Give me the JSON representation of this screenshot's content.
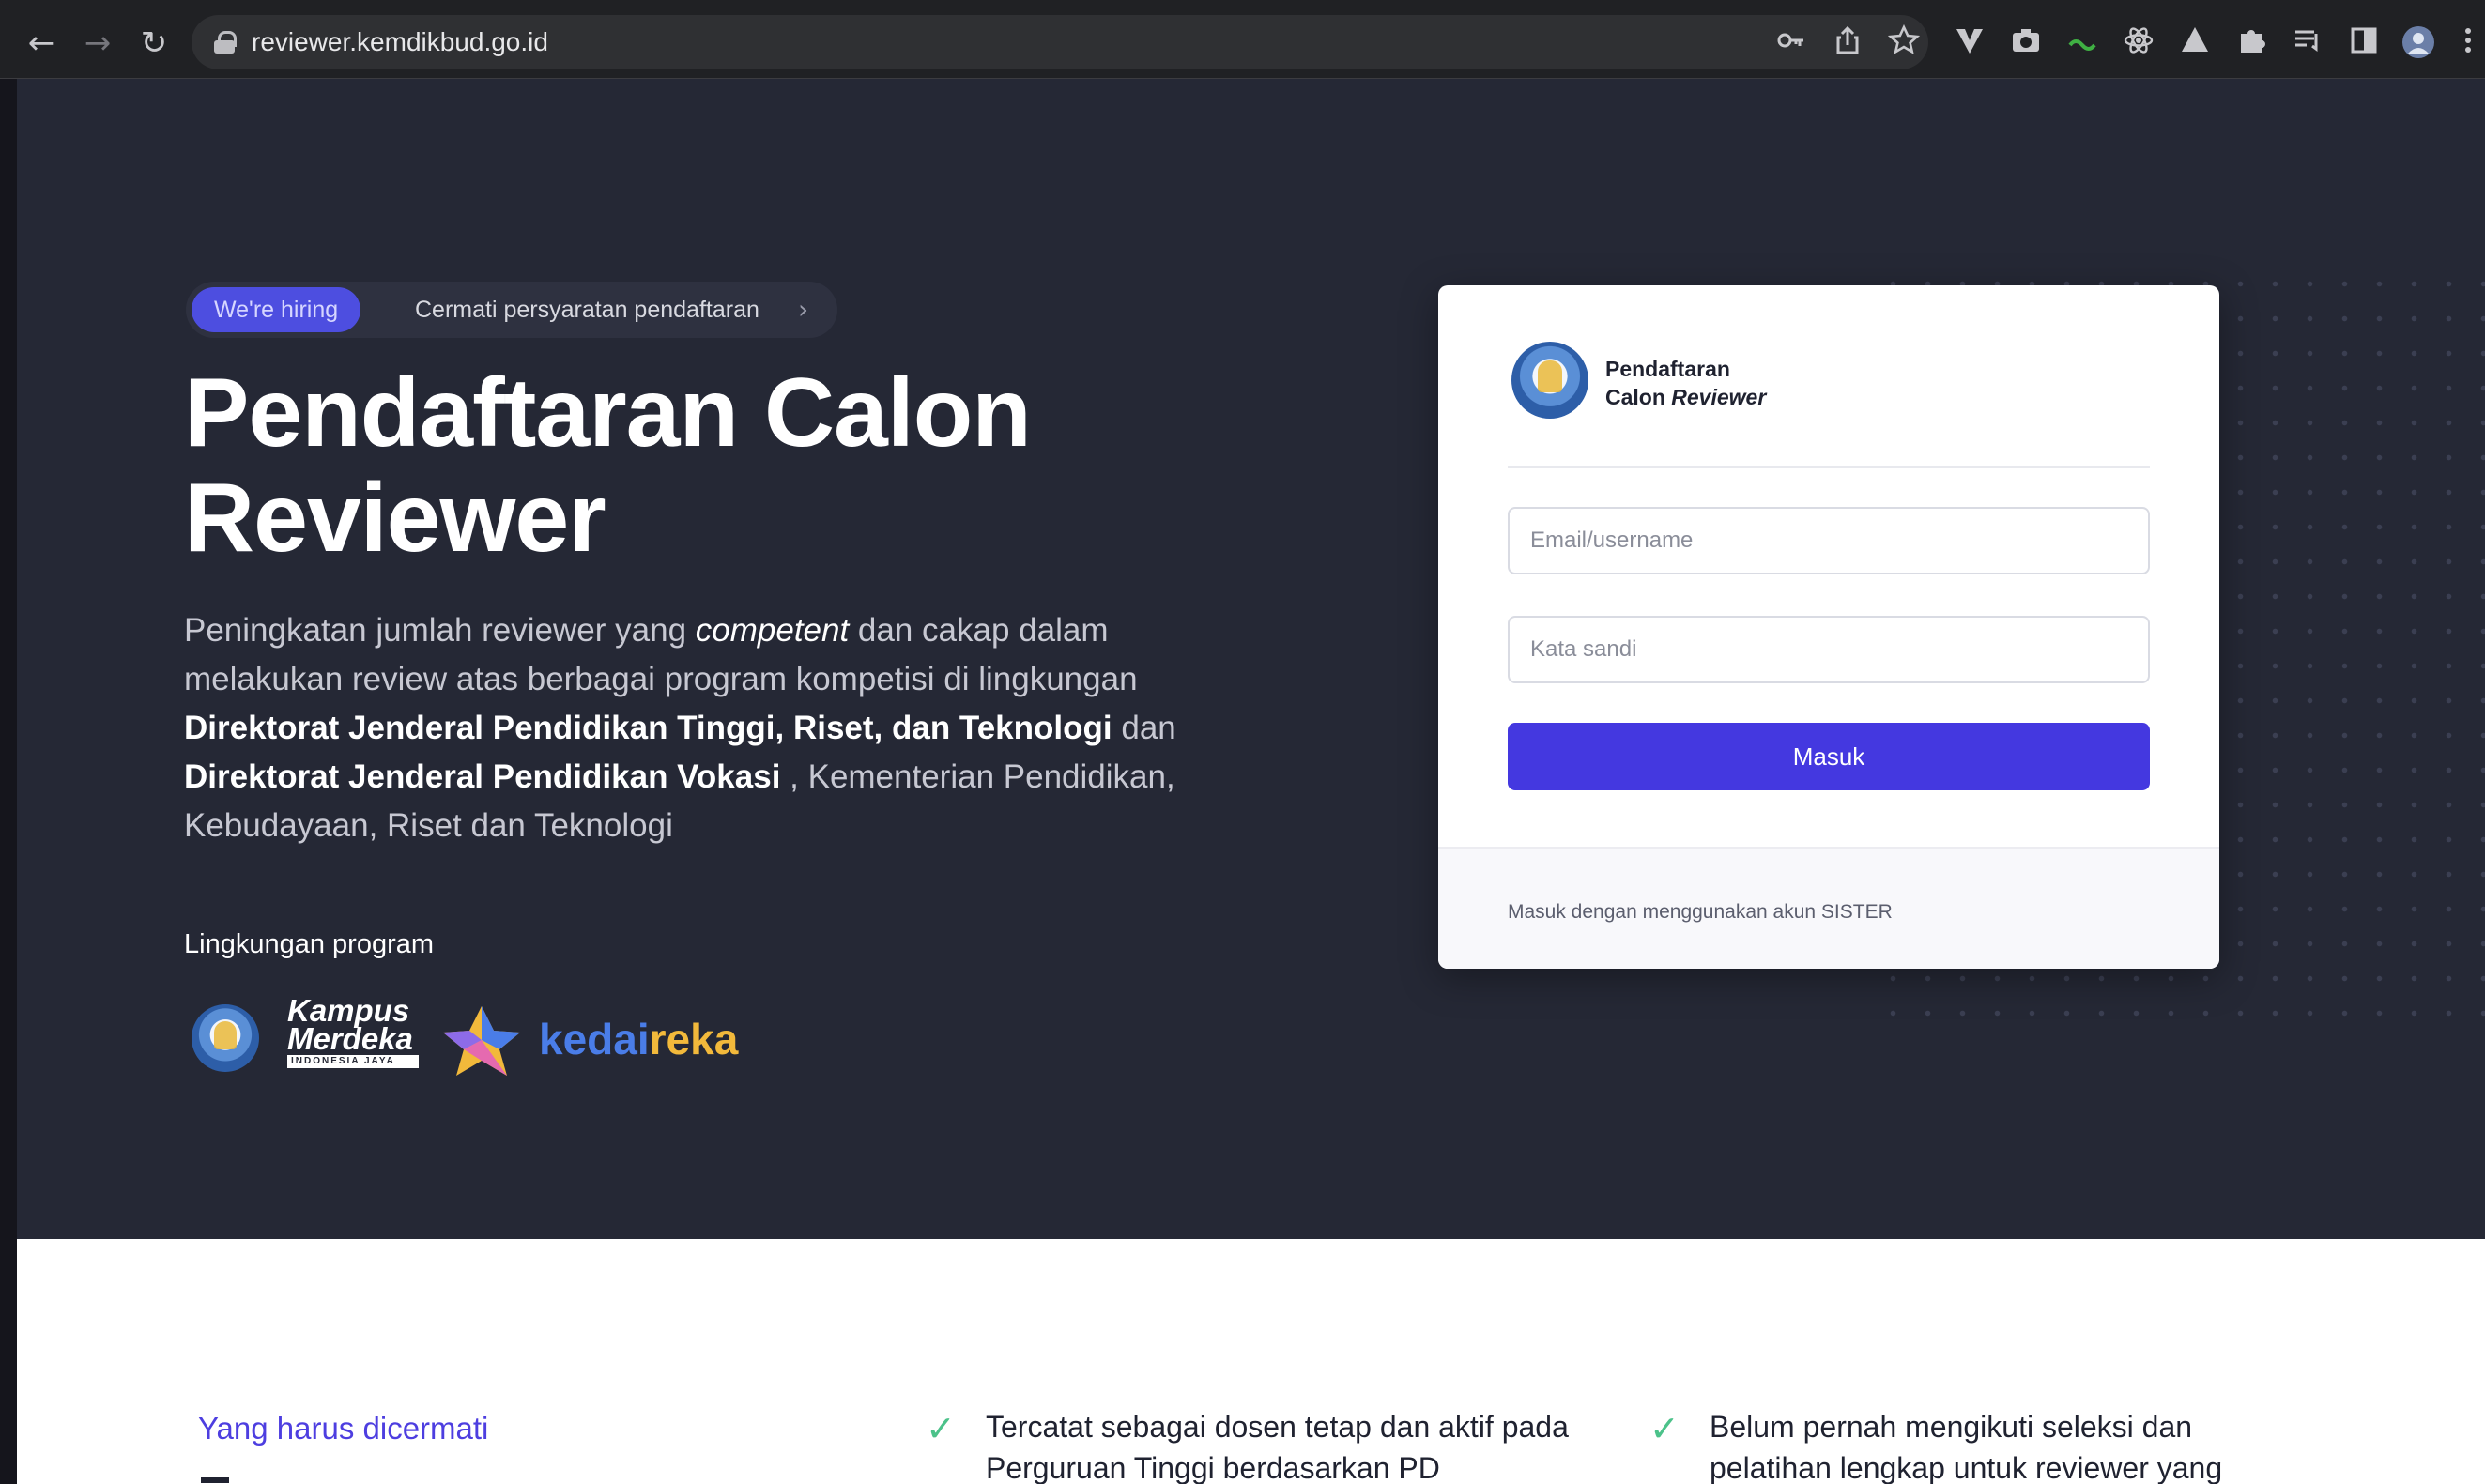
{
  "browser": {
    "url": "reviewer.kemdikbud.go.id",
    "back_glyph": "←",
    "forward_glyph": "→",
    "reload_glyph": "↻",
    "extension_icons": [
      "key-icon",
      "share-icon",
      "star-icon",
      "vivaldi-icon",
      "camera-icon",
      "bw-extension-icon",
      "react-devtools-icon",
      "drive-icon",
      "puzzle-icon",
      "reading-list-icon",
      "sidebar-icon",
      "profile-avatar",
      "more-menu-icon"
    ]
  },
  "hero": {
    "badge": "We're hiring",
    "pill_text": "Cermati persyaratan pendaftaran",
    "title_line1": "Pendaftaran Calon",
    "title_line2": "Reviewer",
    "desc": {
      "p1": "Peningkatan jumlah reviewer yang ",
      "em": "competent",
      "p2": " dan cakap dalam melakukan review atas berbagai program kompetisi di lingkungan ",
      "b1": "Direktorat Jenderal Pendidikan Tinggi, Riset, dan Teknologi",
      "p3": " dan ",
      "b2": "Direktorat Jenderal Pendidikan Vokasi",
      "p4": " , Kementerian Pendidikan, Kebudayaan, Riset dan Teknologi"
    },
    "program_label": "Lingkungan program",
    "logos": {
      "km_line1": "Kampus",
      "km_line2": "Merdeka",
      "km_tag": "INDONESIA JAYA",
      "kedai": "kedai",
      "reka": "reka"
    }
  },
  "login": {
    "brand_line1": "Pendaftaran",
    "brand_line2_a": "Calon ",
    "brand_line2_b": "Reviewer",
    "email_placeholder": "Email/username",
    "password_placeholder": "Kata sandi",
    "submit_label": "Masuk",
    "footer_text": "Masuk dengan menggunakan akun SISTER"
  },
  "lower": {
    "section_label": "Yang harus dicermati",
    "requirements": [
      {
        "text": "Tercatat sebagai dosen tetap dan aktif pada Perguruan Tinggi berdasarkan PD"
      },
      {
        "text": "Belum pernah mengikuti seleksi dan pelatihan lengkap untuk reviewer yang"
      }
    ],
    "check_glyph": "✓"
  },
  "colors": {
    "accent": "#4438e0",
    "hero_bg": "#252835",
    "badge": "#4d4ee0",
    "check": "#4cc28a",
    "kedai_blue": "#4a7de8",
    "reka_yellow": "#f2b93b"
  }
}
